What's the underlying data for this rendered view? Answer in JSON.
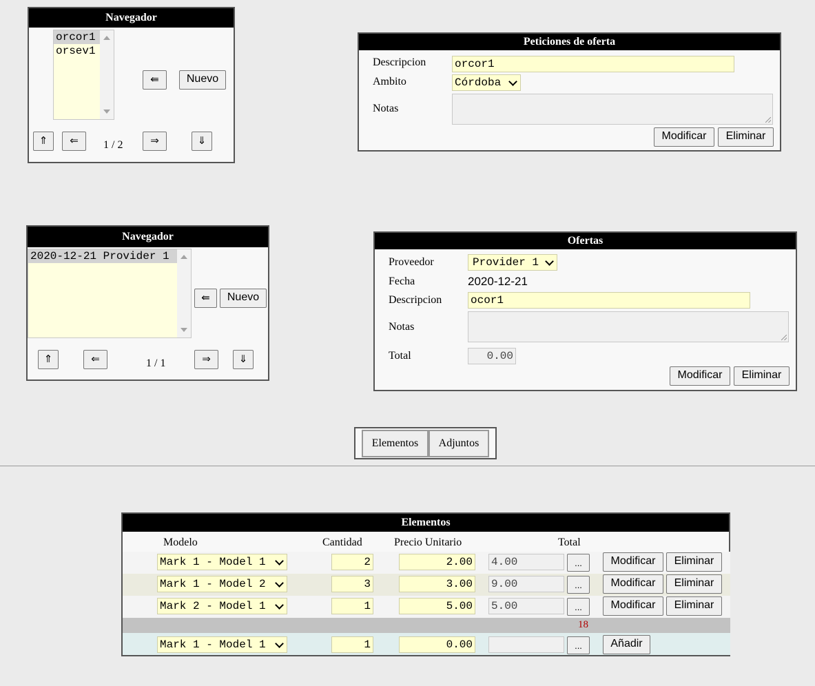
{
  "nav1": {
    "title": "Navegador",
    "items": [
      "orcor1",
      "orsev1"
    ],
    "back_symbol": "⇚",
    "new_label": "Nuevo",
    "first_symbol": "⇑",
    "prev_symbol": "⇐",
    "page": "1 / 2",
    "next_symbol": "⇒",
    "last_symbol": "⇓"
  },
  "peticiones": {
    "title": "Peticiones de oferta",
    "descripcion_label": "Descripcion",
    "descripcion_value": "orcor1",
    "ambito_label": "Ambito",
    "ambito_value": "Córdoba",
    "notas_label": "Notas",
    "notas_value": "",
    "modify_label": "Modificar",
    "delete_label": "Eliminar"
  },
  "nav2": {
    "title": "Navegador",
    "items": [
      "2020-12-21 Provider 1"
    ],
    "back_symbol": "⇚",
    "new_label": "Nuevo",
    "first_symbol": "⇑",
    "prev_symbol": "⇐",
    "page": "1 / 1",
    "next_symbol": "⇒",
    "last_symbol": "⇓"
  },
  "ofertas": {
    "title": "Ofertas",
    "proveedor_label": "Proveedor",
    "proveedor_value": "Provider 1",
    "fecha_label": "Fecha",
    "fecha_value": "2020-12-21",
    "descripcion_label": "Descripcion",
    "descripcion_value": "ocor1",
    "notas_label": "Notas",
    "notas_value": "",
    "total_label": "Total",
    "total_value": "0.00",
    "modify_label": "Modificar",
    "delete_label": "Eliminar"
  },
  "tabs": [
    "Elementos",
    "Adjuntos"
  ],
  "elementos": {
    "title": "Elementos",
    "headers": {
      "modelo": "Modelo",
      "cantidad": "Cantidad",
      "precio": "Precio Unitario",
      "total": "Total"
    },
    "rows": [
      {
        "modelo": "Mark 1 - Model 1",
        "cantidad": "2",
        "precio": "2.00",
        "total": "4.00",
        "dots": "...",
        "modify": "Modificar",
        "delete": "Eliminar"
      },
      {
        "modelo": "Mark 1 - Model 2",
        "cantidad": "3",
        "precio": "3.00",
        "total": "9.00",
        "dots": "...",
        "modify": "Modificar",
        "delete": "Eliminar"
      },
      {
        "modelo": "Mark 2 - Model 1",
        "cantidad": "1",
        "precio": "5.00",
        "total": "5.00",
        "dots": "...",
        "modify": "Modificar",
        "delete": "Eliminar"
      }
    ],
    "sum": "18",
    "new_row": {
      "modelo": "Mark 1 - Model 1",
      "cantidad": "1",
      "precio": "0.00",
      "total": "",
      "dots": "...",
      "add": "Añadir"
    }
  }
}
